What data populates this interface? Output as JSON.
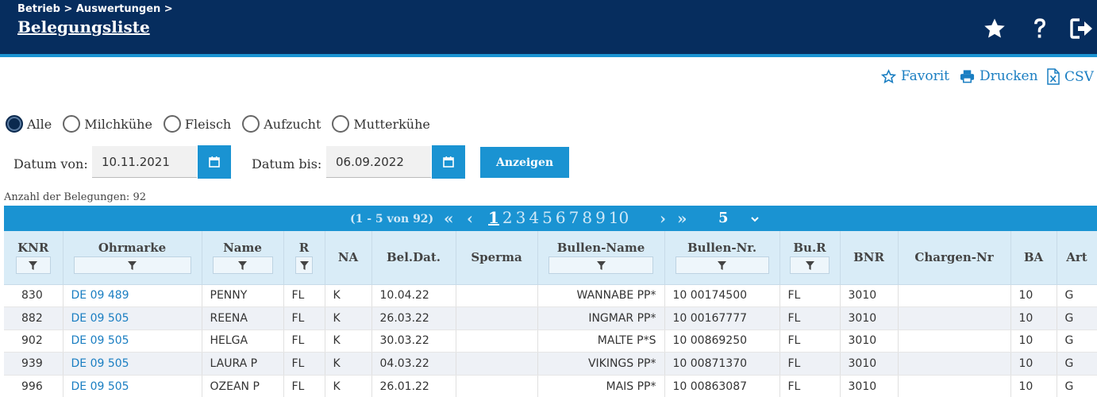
{
  "header": {
    "breadcrumb": "Betrieb > Auswertungen >",
    "title": "Belegungsliste",
    "icons": [
      "star-icon",
      "help-icon",
      "logout-icon"
    ]
  },
  "actions": {
    "favorit": "Favorit",
    "drucken": "Drucken",
    "csv": "CSV"
  },
  "filters": {
    "radios": [
      "Alle",
      "Milchkühe",
      "Fleisch",
      "Aufzucht",
      "Mutterkühe"
    ],
    "selected": "Alle",
    "date_from_label": "Datum von:",
    "date_from": "10.11.2021",
    "date_to_label": "Datum bis:",
    "date_to": "06.09.2022",
    "show_button": "Anzeigen"
  },
  "summary": "Anzahl der Belegungen: 92",
  "pager": {
    "info": "(1 - 5 von 92)",
    "pages": [
      "1",
      "2",
      "3",
      "4",
      "5",
      "6",
      "7",
      "8",
      "9",
      "10"
    ],
    "active": "1",
    "page_size": "5"
  },
  "table": {
    "columns": [
      "KNR",
      "Ohrmarke",
      "Name",
      "R",
      "NA",
      "Bel.Dat.",
      "Sperma",
      "Bullen-Name",
      "Bullen-Nr.",
      "Bu.R",
      "BNR",
      "Chargen-Nr",
      "BA",
      "Art"
    ],
    "rows": [
      [
        "830",
        "DE 09 489",
        "PENNY",
        "FL",
        "K",
        "10.04.22",
        "",
        "WANNABE PP*",
        "10 00174500",
        "FL",
        "3010",
        "",
        "10",
        "G"
      ],
      [
        "882",
        "DE 09 505",
        "REENA",
        "FL",
        "K",
        "26.03.22",
        "",
        "INGMAR PP*",
        "10 00167777",
        "FL",
        "3010",
        "",
        "10",
        "G"
      ],
      [
        "902",
        "DE 09 505",
        "HELGA",
        "FL",
        "K",
        "30.03.22",
        "",
        "MALTE P*S",
        "10 00869250",
        "FL",
        "3010",
        "",
        "10",
        "G"
      ],
      [
        "939",
        "DE 09 505",
        "LAURA P",
        "FL",
        "K",
        "04.03.22",
        "",
        "VIKINGS PP*",
        "10 00871370",
        "FL",
        "3010",
        "",
        "10",
        "G"
      ],
      [
        "996",
        "DE 09 505",
        "OZEAN P",
        "FL",
        "K",
        "26.01.22",
        "",
        "MAIS PP*",
        "10 00863087",
        "FL",
        "3010",
        "",
        "10",
        "G"
      ]
    ]
  },
  "colors": {
    "header_bg": "#062d5e",
    "accent": "#1a93d2",
    "link": "#1a7ec2",
    "table_header_bg": "#d9ecf7",
    "alt_row_bg": "#eef1f6"
  }
}
